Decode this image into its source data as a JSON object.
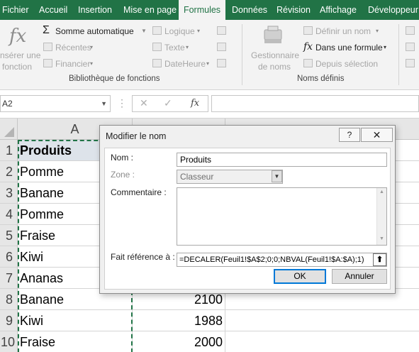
{
  "ribbon": {
    "tabs": [
      {
        "label": "Fichier",
        "active": false
      },
      {
        "label": "Accueil",
        "active": false
      },
      {
        "label": "Insertion",
        "active": false
      },
      {
        "label": "Mise en page",
        "active": false
      },
      {
        "label": "Formules",
        "active": true
      },
      {
        "label": "Données",
        "active": false
      },
      {
        "label": "Révision",
        "active": false
      },
      {
        "label": "Affichage",
        "active": false
      },
      {
        "label": "Développeur",
        "active": false
      }
    ],
    "insert_function": {
      "line1": "nsérer une",
      "line2": "fonction"
    },
    "autosum": "Somme automatique",
    "recent": "Récentes",
    "financial": "Financier",
    "logical": "Logique",
    "text": "Texte",
    "datetime": "DateHeure",
    "function_library_label": "Bibliothèque de fonctions",
    "name_manager": {
      "line1": "Gestionnaire",
      "line2": "de noms"
    },
    "define_name": "Définir un nom",
    "use_in_formula": "Dans une formule",
    "create_from_selection": "Depuis sélection",
    "defined_names_label": "Noms définis"
  },
  "formula_bar": {
    "name_box": "A2",
    "fx": "fx"
  },
  "sheet": {
    "col_a": "A",
    "rows": [
      {
        "n": "1",
        "a": "Produits",
        "b": ""
      },
      {
        "n": "2",
        "a": "Pomme",
        "b": ""
      },
      {
        "n": "3",
        "a": "Banane",
        "b": ""
      },
      {
        "n": "4",
        "a": "Pomme",
        "b": ""
      },
      {
        "n": "5",
        "a": "Fraise",
        "b": ""
      },
      {
        "n": "6",
        "a": "Kiwi",
        "b": ""
      },
      {
        "n": "7",
        "a": "Ananas",
        "b": ""
      },
      {
        "n": "8",
        "a": "Banane",
        "b": "2100"
      },
      {
        "n": "9",
        "a": "Kiwi",
        "b": "1988"
      },
      {
        "n": "10",
        "a": "Fraise",
        "b": "2000"
      }
    ]
  },
  "dialog": {
    "title": "Modifier le nom",
    "help": "?",
    "close": "✕",
    "name_label": "Nom :",
    "name_value": "Produits",
    "scope_label": "Zone :",
    "scope_value": "Classeur",
    "comment_label": "Commentaire :",
    "comment_value": "",
    "refers_label": "Fait référence à :",
    "refers_value": "=DECALER(Feuil1!$A$2;0;0;NBVAL(Feuil1!$A:$A);1)",
    "ok": "OK",
    "cancel": "Annuler"
  },
  "colors": {
    "excel_green": "#217346",
    "accent_blue": "#0078d7"
  }
}
